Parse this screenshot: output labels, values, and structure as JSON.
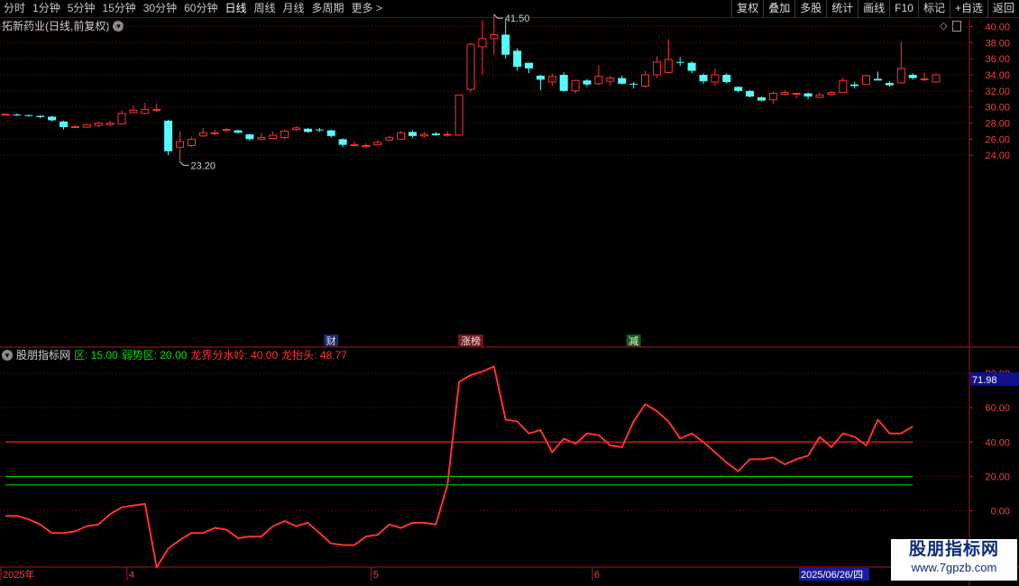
{
  "toolbar": {
    "periods": [
      "分时",
      "1分钟",
      "5分钟",
      "15分钟",
      "30分钟",
      "60分钟",
      "日线",
      "周线",
      "月线",
      "多周期",
      "更多 >"
    ],
    "active_period": "日线",
    "tools": [
      "复权",
      "叠加",
      "多股",
      "统计",
      "画线",
      "F10",
      "+自选",
      "返回"
    ],
    "mark_button": "标记"
  },
  "price_panel": {
    "title": "拓新药业(日线,前复权)",
    "high_label": "41.50",
    "low_label": "23.20",
    "y_ticks": [
      "40.00",
      "38.00",
      "36.00",
      "34.00",
      "32.00",
      "30.00",
      "28.00",
      "26.00",
      "24.00"
    ],
    "events": [
      "财",
      "涨榜",
      "减"
    ],
    "colors": {
      "up": "#ff3232",
      "down": "#54fcfc"
    }
  },
  "indicator_panel": {
    "name": "股朋指标网",
    "params": [
      {
        "label": "区: 15.00",
        "color": "#00e000"
      },
      {
        "label": "弱势区: 20.00",
        "color": "#00e000"
      },
      {
        "label": "龙界分水岭: 40.00",
        "color": "#ff3232"
      },
      {
        "label": "龙抬头: 48.77",
        "color": "#ff3232"
      }
    ],
    "y_ticks": [
      "80.00",
      "60.00",
      "40.00",
      "20.00",
      "0.00"
    ],
    "current_value": "71.98"
  },
  "x_axis": {
    "labels": [
      "2025年",
      "4",
      "5",
      "6"
    ],
    "cursor_date": "2025/06/26/四"
  },
  "watermark": {
    "title": "股朋指标网",
    "url": "www.7gpzb.com"
  },
  "chart_data": [
    {
      "type": "candlestick",
      "title": "拓新药业(日线,前复权)",
      "ylim": [
        23,
        42
      ],
      "annotations": {
        "max": 41.5,
        "min": 23.2
      },
      "events": [
        {
          "label": "财",
          "index": 28
        },
        {
          "label": "涨榜",
          "index": 40
        },
        {
          "label": "减",
          "index": 54
        }
      ],
      "candles": [
        [
          29.0,
          29.1,
          29.15,
          28.95
        ],
        [
          29.05,
          29.0,
          29.2,
          28.9
        ],
        [
          29.0,
          28.9,
          29.05,
          28.8
        ],
        [
          28.9,
          28.75,
          29.0,
          28.6
        ],
        [
          28.8,
          28.35,
          28.9,
          28.2
        ],
        [
          28.2,
          27.5,
          28.3,
          27.2
        ],
        [
          27.5,
          27.55,
          27.8,
          27.4
        ],
        [
          27.5,
          27.8,
          27.9,
          27.4
        ],
        [
          27.7,
          28.0,
          28.2,
          27.5
        ],
        [
          27.8,
          28.0,
          28.3,
          27.6
        ],
        [
          27.9,
          29.2,
          29.6,
          27.8
        ],
        [
          29.3,
          29.6,
          30.2,
          29.2
        ],
        [
          29.2,
          29.7,
          30.5,
          29.1
        ],
        [
          29.6,
          29.7,
          30.4,
          29.4
        ],
        [
          28.3,
          24.5,
          28.4,
          24.0
        ],
        [
          25.0,
          25.7,
          27.0,
          23.2
        ],
        [
          25.2,
          26.0,
          26.3,
          25.0
        ],
        [
          26.4,
          26.8,
          27.4,
          26.3
        ],
        [
          26.7,
          26.8,
          27.2,
          26.5
        ],
        [
          27.2,
          27.2,
          27.4,
          27.0
        ],
        [
          27.1,
          26.8,
          27.2,
          26.7
        ],
        [
          26.6,
          26.0,
          26.7,
          25.8
        ],
        [
          26.0,
          26.2,
          26.8,
          25.9
        ],
        [
          26.1,
          26.5,
          27.0,
          26.0
        ],
        [
          26.2,
          27.0,
          27.2,
          26.0
        ],
        [
          27.2,
          27.4,
          27.6,
          27.0
        ],
        [
          27.3,
          26.9,
          27.4,
          26.8
        ],
        [
          27.2,
          27.1,
          27.4,
          26.9
        ],
        [
          27.1,
          26.4,
          27.2,
          26.2
        ],
        [
          26.0,
          25.3,
          26.1,
          25.0
        ],
        [
          25.2,
          25.3,
          25.7,
          25.1
        ],
        [
          25.2,
          25.2,
          25.5,
          25.0
        ],
        [
          25.3,
          25.6,
          25.9,
          25.2
        ],
        [
          25.9,
          26.2,
          26.4,
          25.8
        ],
        [
          26.0,
          26.8,
          27.0,
          25.9
        ],
        [
          26.9,
          26.4,
          27.1,
          26.2
        ],
        [
          26.4,
          26.6,
          26.9,
          26.2
        ],
        [
          26.7,
          26.5,
          26.9,
          26.4
        ],
        [
          26.6,
          26.6,
          27.0,
          26.3
        ],
        [
          26.5,
          31.5,
          31.6,
          26.4
        ],
        [
          32.2,
          37.8,
          38.0,
          31.8
        ],
        [
          37.5,
          38.5,
          40.8,
          34.0
        ],
        [
          38.5,
          39.0,
          41.5,
          36.5
        ],
        [
          39.0,
          36.5,
          40.8,
          36.0
        ],
        [
          37.0,
          35.0,
          37.3,
          34.5
        ],
        [
          35.5,
          34.8,
          35.5,
          34.2
        ],
        [
          33.9,
          33.4,
          34.0,
          32.1
        ],
        [
          33.1,
          33.8,
          34.2,
          32.6
        ],
        [
          34.0,
          32.0,
          34.3,
          31.9
        ],
        [
          32.0,
          33.3,
          33.4,
          31.7
        ],
        [
          33.3,
          32.8,
          33.5,
          32.5
        ],
        [
          32.9,
          33.8,
          35.2,
          32.7
        ],
        [
          33.2,
          33.6,
          33.9,
          32.6
        ],
        [
          33.6,
          32.9,
          33.9,
          32.8
        ],
        [
          32.9,
          32.8,
          33.1,
          32.3
        ],
        [
          32.6,
          34.0,
          34.5,
          32.4
        ],
        [
          34.0,
          35.6,
          36.3,
          33.6
        ],
        [
          34.3,
          35.9,
          38.4,
          34.1
        ],
        [
          35.6,
          35.5,
          36.2,
          35.1
        ],
        [
          35.5,
          34.5,
          35.7,
          34.2
        ],
        [
          34.0,
          33.2,
          34.2,
          32.9
        ],
        [
          33.1,
          34.0,
          34.8,
          32.6
        ],
        [
          34.0,
          33.1,
          34.2,
          32.9
        ],
        [
          32.5,
          32.0,
          32.6,
          31.8
        ],
        [
          32.0,
          31.3,
          32.1,
          31.2
        ],
        [
          31.2,
          30.8,
          31.3,
          30.7
        ],
        [
          30.9,
          31.7,
          31.9,
          30.4
        ],
        [
          31.6,
          31.8,
          32.1,
          31.5
        ],
        [
          31.7,
          31.7,
          31.8,
          31.1
        ],
        [
          31.7,
          31.3,
          31.8,
          31.0
        ],
        [
          31.2,
          31.5,
          31.8,
          31.1
        ],
        [
          31.6,
          31.8,
          32.0,
          31.4
        ],
        [
          31.8,
          33.3,
          33.7,
          31.8
        ],
        [
          32.8,
          32.6,
          33.1,
          32.3
        ],
        [
          32.8,
          33.9,
          34.0,
          32.8
        ],
        [
          33.5,
          33.3,
          34.4,
          33.3
        ],
        [
          33.0,
          32.7,
          33.2,
          32.5
        ],
        [
          33.0,
          34.8,
          38.1,
          32.9
        ],
        [
          34.0,
          33.6,
          34.2,
          33.4
        ],
        [
          33.5,
          33.5,
          34.3,
          33.2
        ],
        [
          33.1,
          34.0,
          34.2,
          33.1
        ]
      ]
    },
    {
      "type": "line",
      "title": "股朋指标网",
      "ylim": [
        -20,
        90
      ],
      "series": [
        {
          "name": "龙抬头",
          "color": "#ff3232",
          "values": [
            -3,
            -3,
            -5,
            -8,
            -13,
            -13,
            -12,
            -9,
            -8,
            -2,
            2,
            3,
            4,
            -33,
            -22,
            -17,
            -13,
            -13,
            -10,
            -11,
            -16,
            -15,
            -15,
            -9,
            -6,
            -9,
            -7,
            -13,
            -19,
            -20,
            -20,
            -15,
            -14,
            -8,
            -10,
            -7,
            -7,
            -8,
            15,
            75,
            79,
            81,
            84,
            53,
            52,
            45,
            47,
            34,
            42,
            39,
            45,
            44,
            38,
            37,
            52,
            62,
            58,
            52,
            42,
            45,
            40,
            34,
            28,
            23,
            30,
            30,
            31,
            27,
            30,
            32,
            43,
            37,
            45,
            43,
            38,
            53,
            45,
            45,
            49
          ]
        },
        {
          "name": "龙界分水岭",
          "color": "#ff3232",
          "values": [
            40
          ]
        },
        {
          "name": "弱势区",
          "color": "#00e000",
          "values": [
            20
          ]
        },
        {
          "name": "区",
          "color": "#00e000",
          "values": [
            15
          ]
        }
      ]
    }
  ]
}
